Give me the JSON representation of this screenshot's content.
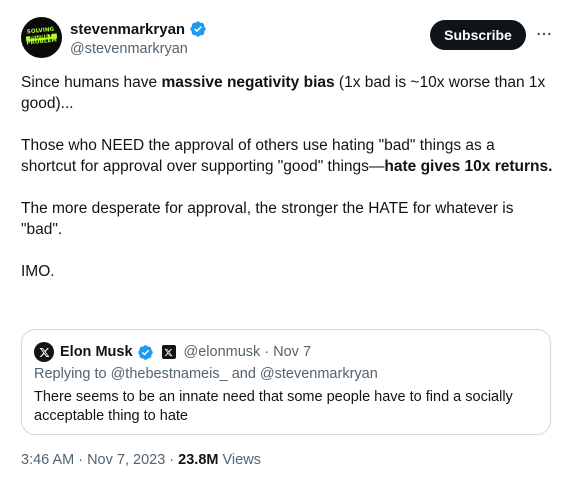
{
  "author": {
    "display_name": "stevenmarkryan",
    "handle": "@stevenmarkryan",
    "avatar_text": [
      "SOLVING",
      "MONEY",
      "PROBLEM"
    ],
    "verified_color": "#1d9bf0"
  },
  "actions": {
    "subscribe_label": "Subscribe",
    "more_icon": "more-horizontal-icon"
  },
  "tweet": {
    "p1_a": "Since humans have ",
    "p1_b": "massive negativity bias",
    "p1_c": " (1x bad is ~10x worse than 1x good)...",
    "p2_a": "Those who NEED the approval of others use hating \"bad\" things as a shortcut for approval over supporting \"good\" things—",
    "p2_b": "hate gives 10x returns.",
    "p3": "The more desperate for approval, the stronger the HATE for whatever is \"bad\".",
    "p4": "IMO."
  },
  "quoted": {
    "display_name": "Elon Musk",
    "handle": "@elonmusk",
    "separator": "·",
    "date": "Nov 7",
    "replying_to": "Replying to @thebestnameis_ and @stevenmarkryan",
    "text": "There seems to be an innate need that some people have to find a socially acceptable thing to hate"
  },
  "meta": {
    "timestamp": "3:46 AM · Nov 7, 2023 · ",
    "views_count": "23.8M",
    "views_label": " Views"
  },
  "colors": {
    "text": "#0f1419",
    "secondary": "#536471",
    "verified": "#1d9bf0",
    "border": "#cfd9de"
  }
}
